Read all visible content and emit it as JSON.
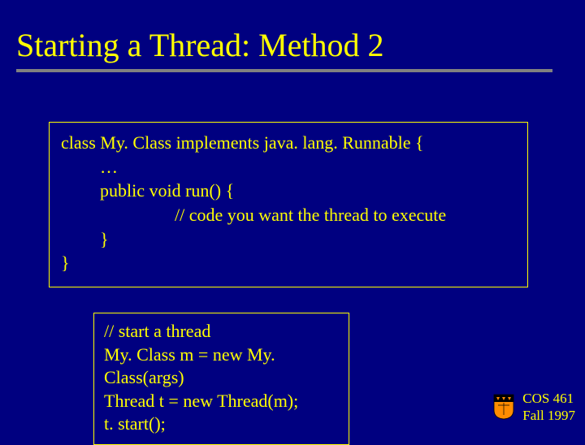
{
  "slide": {
    "title": "Starting a Thread: Method 2"
  },
  "code1": {
    "l1": "class My. Class implements java. lang. Runnable {",
    "l2": "…",
    "l3": "public void run() {",
    "l4": "// code you want the thread to execute",
    "l5": "}",
    "l6": "}"
  },
  "code2": {
    "l1": "// start a thread",
    "l2": "My. Class m = new My. Class(args)",
    "l3": "Thread t = new Thread(m);",
    "l4": "t. start();"
  },
  "footer": {
    "course": "COS 461",
    "term": "Fall 1997"
  }
}
